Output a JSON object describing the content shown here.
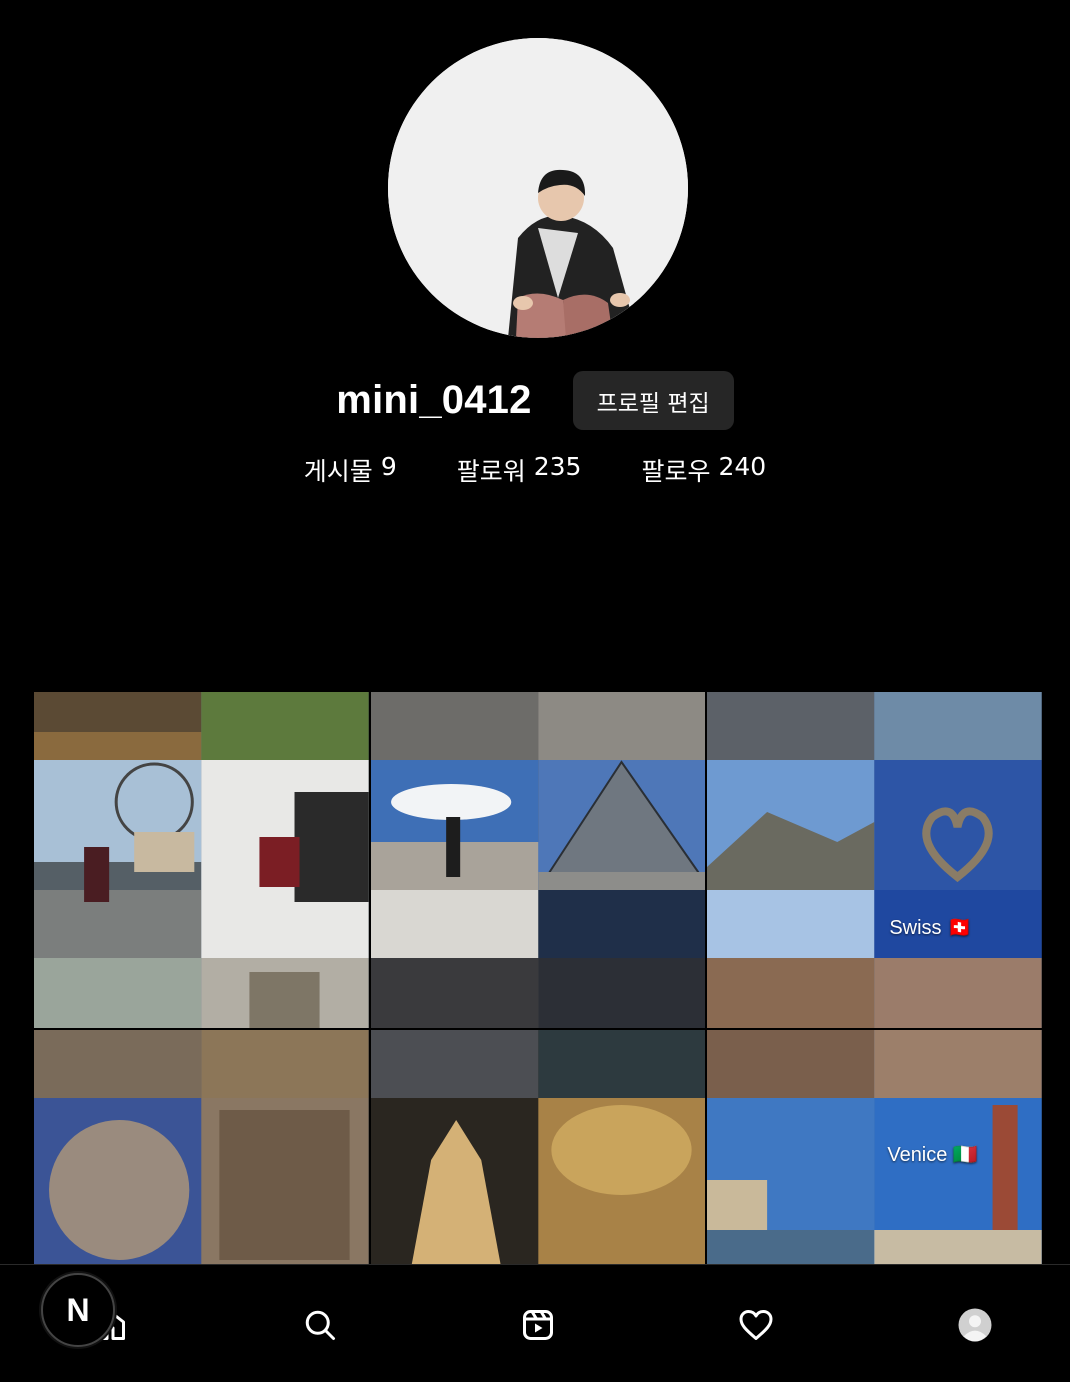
{
  "profile": {
    "username": "mini_0412",
    "edit_button": "프로필 편집",
    "stats": [
      {
        "label": "게시물",
        "value": "9"
      },
      {
        "label": "팔로워",
        "value": "235"
      },
      {
        "label": "팔로우",
        "value": "240"
      }
    ]
  },
  "posts": [
    {
      "tag": ""
    },
    {
      "tag": ""
    },
    {
      "tag": "Swiss 🇨🇭"
    },
    {
      "tag": ""
    },
    {
      "tag": ""
    },
    {
      "tag": "Venice 🇮🇹"
    }
  ],
  "nav": {
    "badge": "N",
    "items": [
      "home-icon",
      "search-icon",
      "reels-icon",
      "heart-icon",
      "profile-icon"
    ]
  },
  "colors": {
    "background": "#000000",
    "button_bg": "#262626",
    "text": "#ffffff"
  }
}
